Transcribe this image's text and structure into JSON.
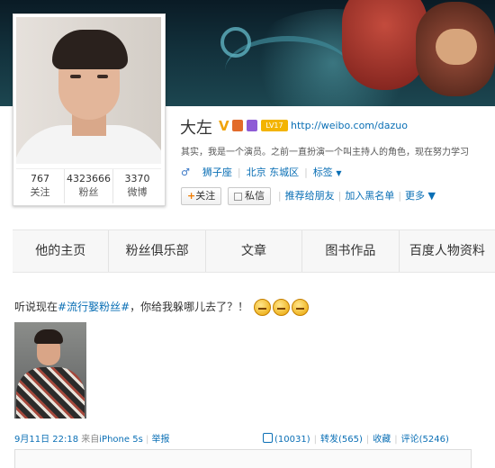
{
  "profile": {
    "name": "大左",
    "verified_mark": "V",
    "badge_1": "",
    "badge_2": "",
    "level": "LV17",
    "url": "http://weibo.com/dazuo",
    "intro": "其实，我是一个演员。之前一直扮演一个叫主持人的角色，现在努力学习",
    "gender_icon": "♂",
    "zodiac": "狮子座",
    "location": "北京 东城区",
    "tags_label": "标签",
    "stats": [
      {
        "value": "767",
        "label": "关注"
      },
      {
        "value": "4323666",
        "label": "粉丝"
      },
      {
        "value": "3370",
        "label": "微博"
      }
    ],
    "actions": {
      "follow": "关注",
      "message": "私信",
      "recommend": "推荐给朋友",
      "blacklist": "加入黑名单",
      "more": "更多"
    }
  },
  "tabs": [
    "他的主页",
    "粉丝俱乐部",
    "文章",
    "图书作品",
    "百度人物资料"
  ],
  "post": {
    "text_before": "听说现在",
    "topic": "#流行娶粉丝#",
    "text_after": "，你给我躲哪儿去了？！",
    "emoji_count": 3,
    "time": "9月11日 22:18",
    "source_prefix": "来自",
    "source": "iPhone 5s",
    "report": "举报",
    "likes": "(10031)",
    "repost": "转发(565)",
    "favorite": "收藏",
    "comment": "评论(5246)"
  },
  "colors": {
    "link": "#0a6fb5",
    "verified": "#f0a30a",
    "level_badge": "#f3b400"
  }
}
